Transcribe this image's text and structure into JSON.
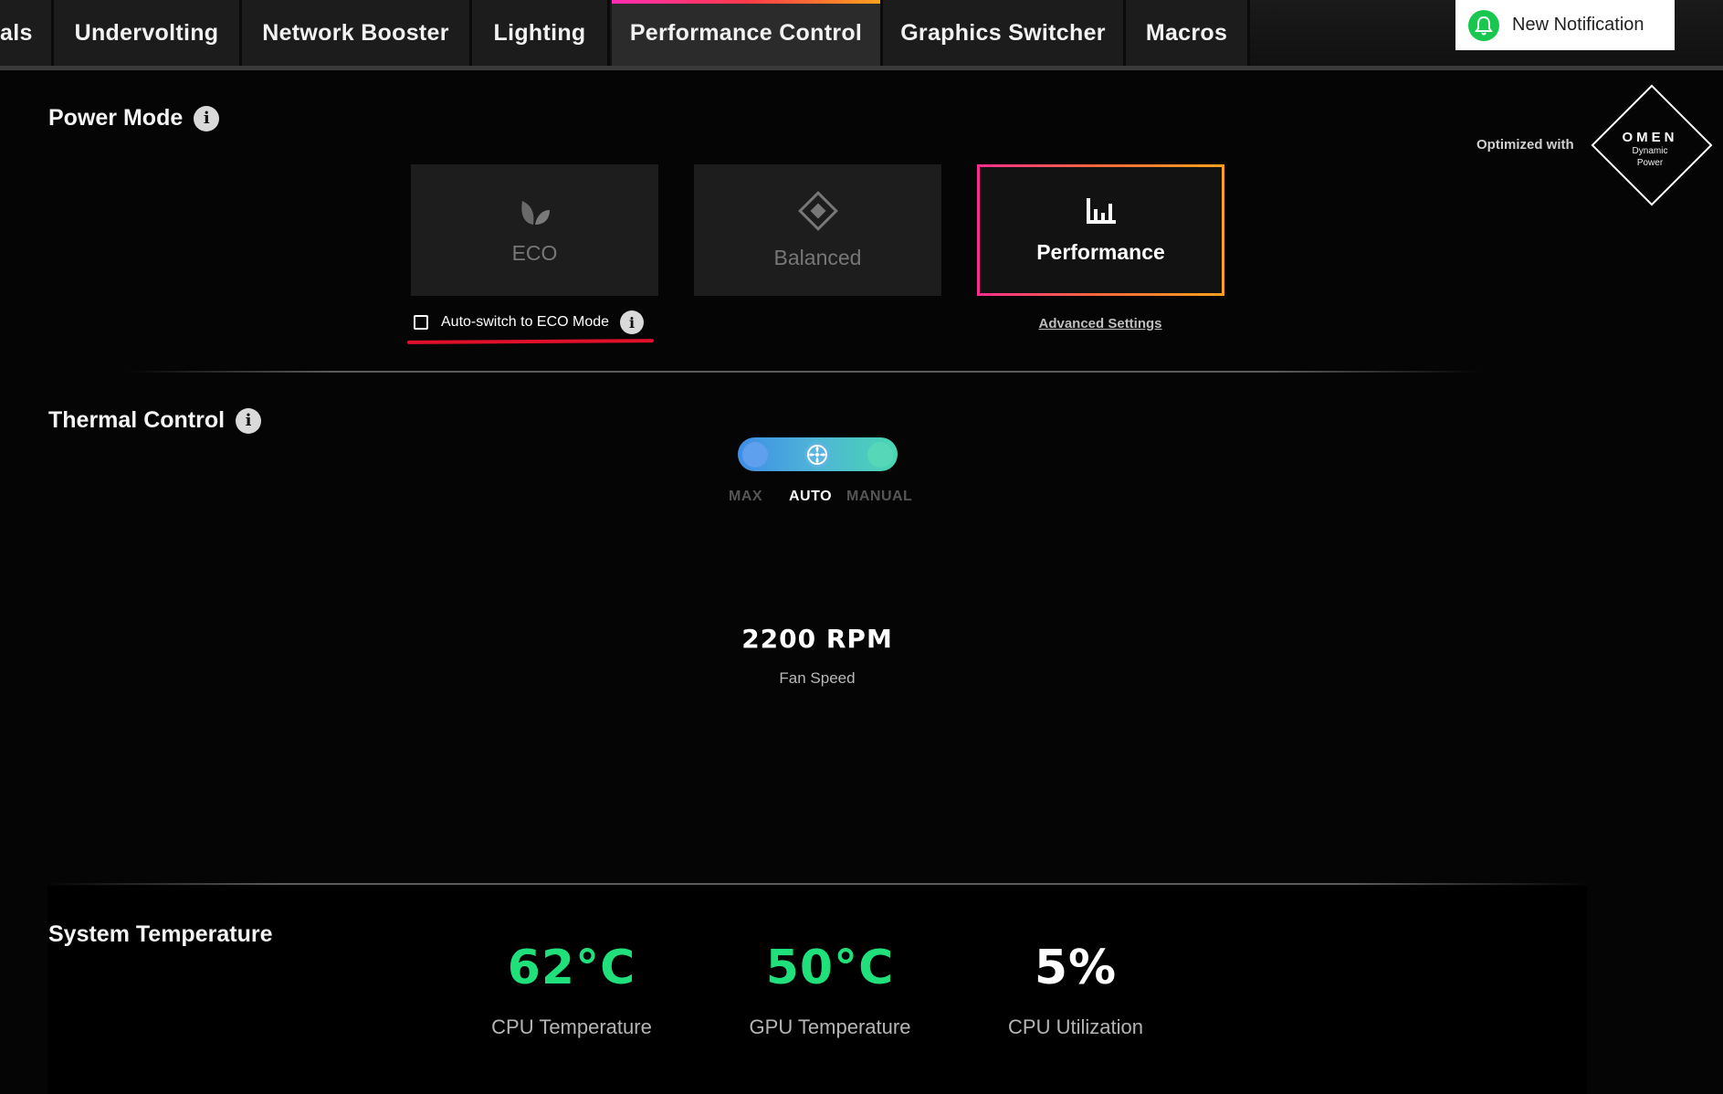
{
  "tabs": [
    {
      "label": "als",
      "active": false
    },
    {
      "label": "Undervolting",
      "active": false
    },
    {
      "label": "Network Booster",
      "active": false
    },
    {
      "label": "Lighting",
      "active": false
    },
    {
      "label": "Performance Control",
      "active": true
    },
    {
      "label": "Graphics Switcher",
      "active": false
    },
    {
      "label": "Macros",
      "active": false
    }
  ],
  "notification": {
    "label": "New Notification",
    "icon": "bell-icon"
  },
  "power_mode": {
    "title": "Power Mode",
    "modes": [
      {
        "label": "ECO",
        "icon": "leaf-icon",
        "selected": false
      },
      {
        "label": "Balanced",
        "icon": "diamond-icon",
        "selected": false
      },
      {
        "label": "Performance",
        "icon": "bars-icon",
        "selected": true
      }
    ],
    "auto_switch_label": "Auto-switch to ECO Mode",
    "auto_switch_checked": false,
    "advanced_settings": "Advanced Settings",
    "optimized_with": "Optimized with",
    "omen_brand": "OMEN",
    "omen_line1": "Dynamic",
    "omen_line2": "Power"
  },
  "thermal_control": {
    "title": "Thermal Control",
    "options": [
      "MAX",
      "AUTO",
      "MANUAL"
    ],
    "selected": "AUTO",
    "fan_speed_value": "2200 RPM",
    "fan_speed_label": "Fan Speed"
  },
  "system_temperature": {
    "title": "System Temperature",
    "metrics": [
      {
        "value": "62°C",
        "label": "CPU Temperature",
        "color": "#1fe07a"
      },
      {
        "value": "50°C",
        "label": "GPU Temperature",
        "color": "#1fe07a"
      },
      {
        "value": "5%",
        "label": "CPU Utilization",
        "color": "#ffffff"
      }
    ]
  },
  "colors": {
    "accent_gradient_start": "#ff2db3",
    "accent_gradient_end": "#ffa21c",
    "annotation_red": "#e0102a"
  }
}
